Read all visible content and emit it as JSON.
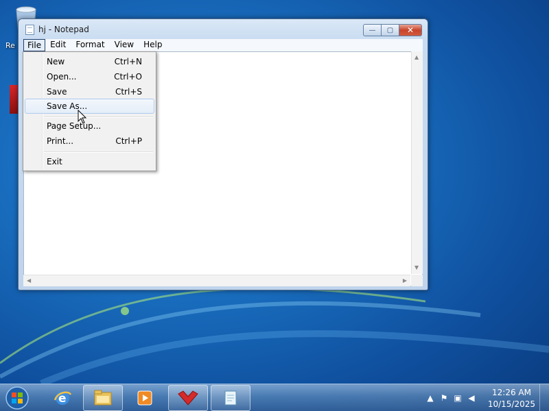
{
  "desktop": {
    "recycle_bin_label": "Re"
  },
  "window": {
    "title": "hj - Notepad",
    "controls": {
      "minimize": "—",
      "maximize": "▢",
      "close": "✕"
    }
  },
  "menubar": {
    "items": [
      "File",
      "Edit",
      "Format",
      "View",
      "Help"
    ],
    "active": "File"
  },
  "file_menu": {
    "items": [
      {
        "label": "New",
        "shortcut": "Ctrl+N"
      },
      {
        "label": "Open...",
        "shortcut": "Ctrl+O"
      },
      {
        "label": "Save",
        "shortcut": "Ctrl+S"
      },
      {
        "label": "Save As...",
        "shortcut": ""
      },
      {
        "label": "Page Setup...",
        "shortcut": ""
      },
      {
        "label": "Print...",
        "shortcut": "Ctrl+P"
      },
      {
        "label": "Exit",
        "shortcut": ""
      }
    ],
    "hovered": "Save As..."
  },
  "editor": {
    "content": ""
  },
  "taskbar": {
    "pinned": [
      "start-orb-icon",
      "internet-explorer-icon",
      "file-explorer-icon",
      "media-player-icon",
      "gns3-icon",
      "notepad-icon"
    ],
    "clock_time": "12:26 AM",
    "clock_date": "10/15/2025",
    "colors": {
      "accent": "#1a6fc0",
      "close": "#c8442c"
    }
  }
}
